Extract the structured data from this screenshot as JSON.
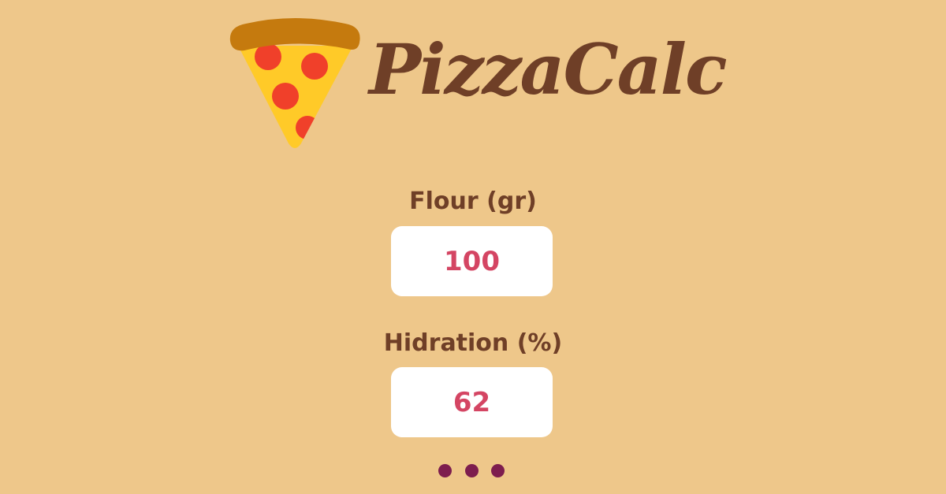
{
  "header": {
    "app_title": "PizzaCalc",
    "logo_icon": "pizza-slice-icon"
  },
  "form": {
    "flour": {
      "label": "Flour (gr)",
      "value": "100"
    },
    "hydration": {
      "label": "Hidration (%)",
      "value": "62"
    }
  },
  "more_indicator": {
    "icon": "more-dots-icon"
  },
  "colors": {
    "background": "#EEC78A",
    "title": "#6F3F27",
    "input_text": "#D44563",
    "dots": "#7D1D4E",
    "crust": "#C57A0E",
    "cheese": "#FFCA28",
    "pepperoni": "#F0402A"
  }
}
